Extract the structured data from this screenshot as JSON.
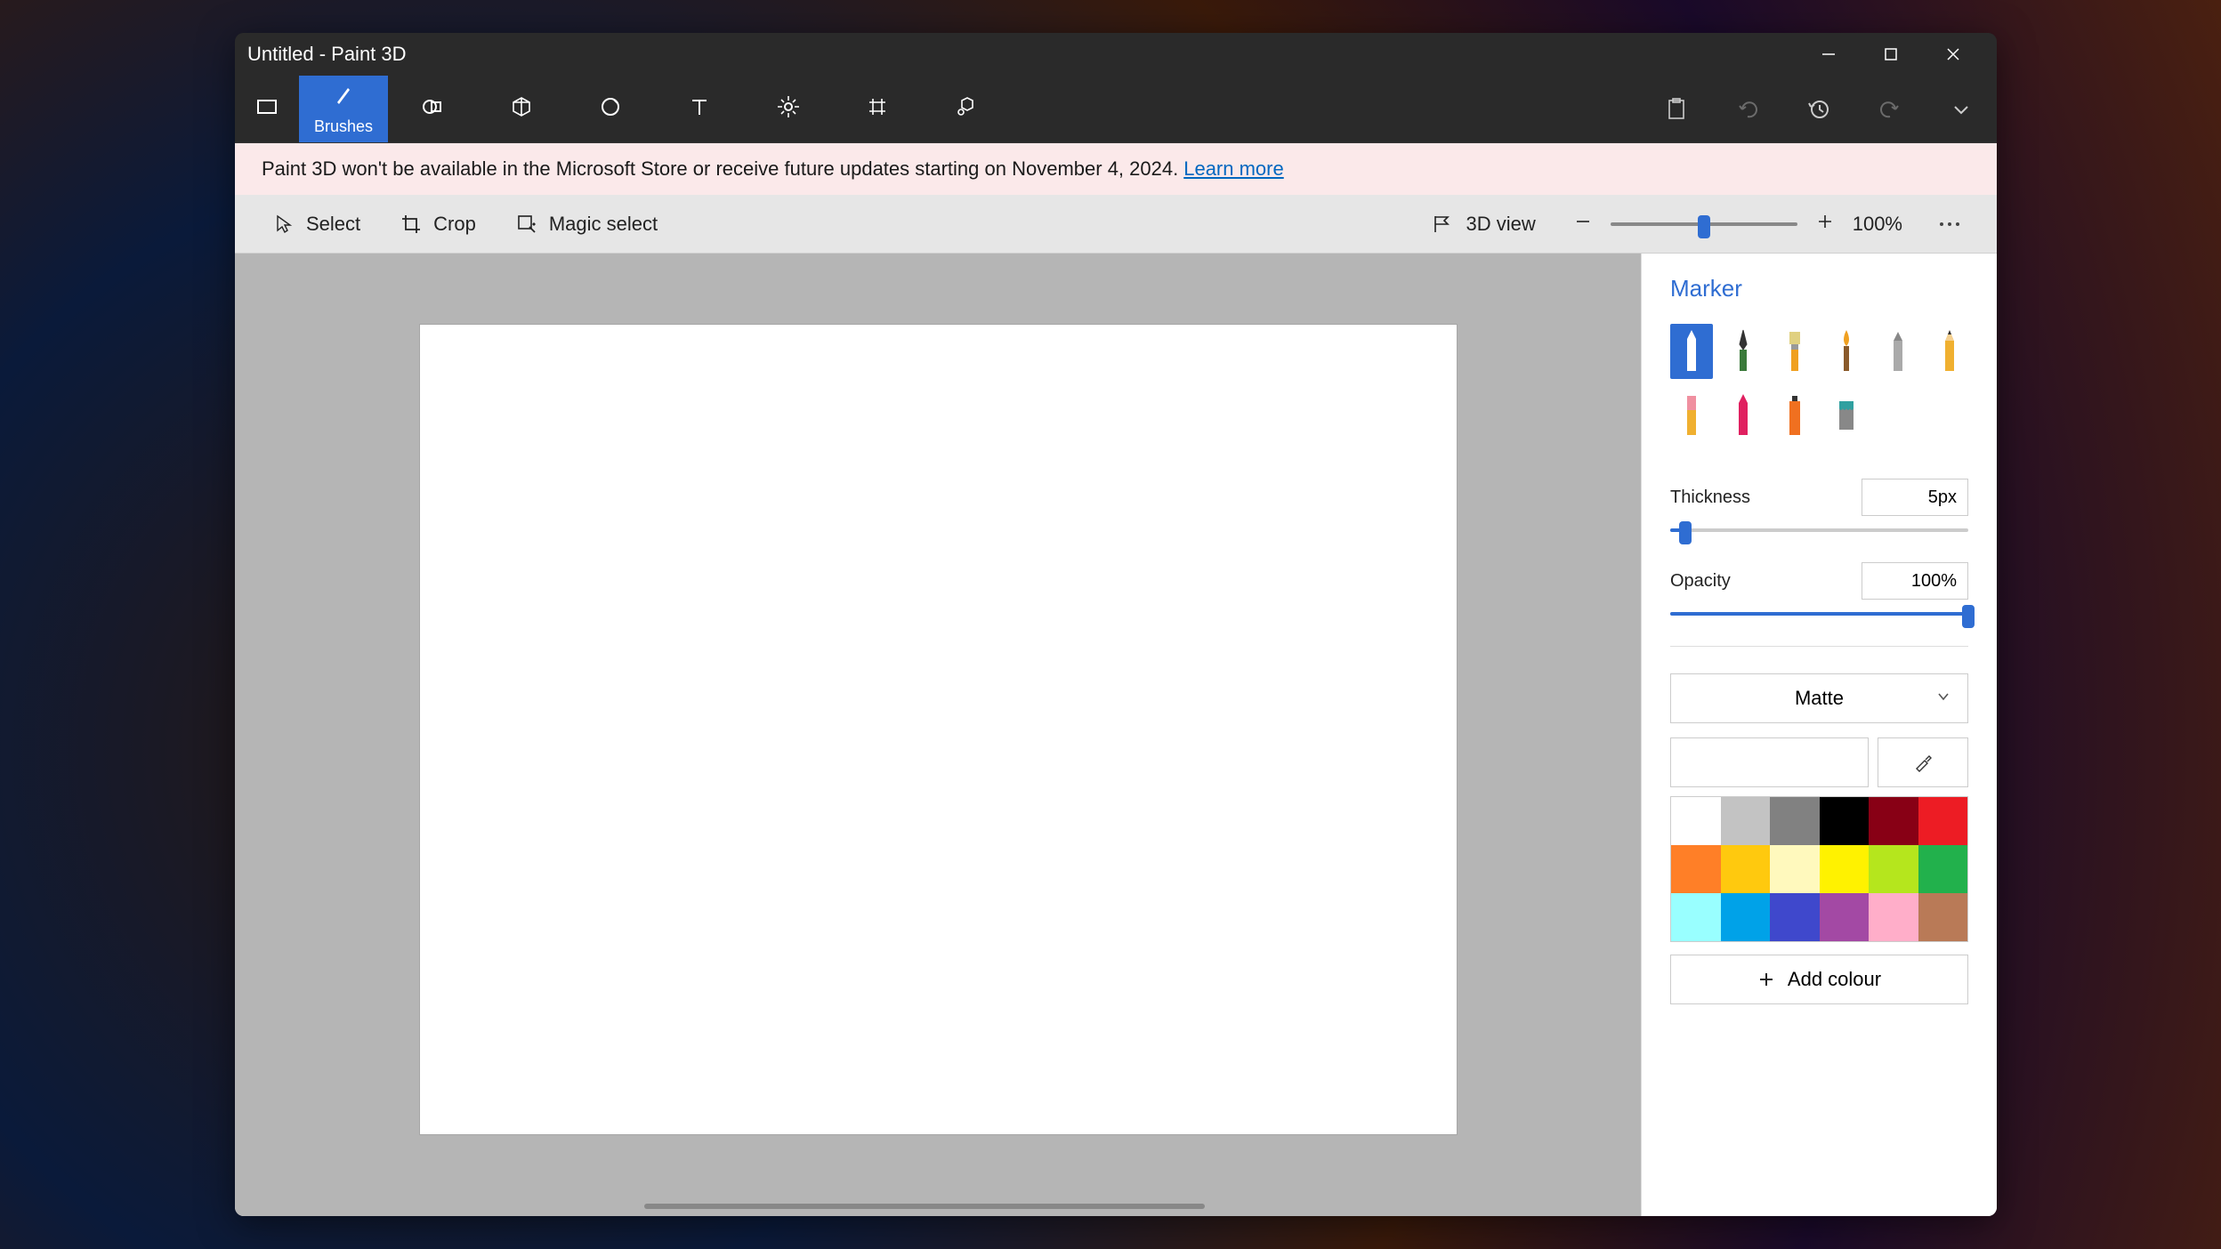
{
  "title": "Untitled - Paint 3D",
  "ribbon": {
    "brushes_label": "Brushes"
  },
  "banner": {
    "text": "Paint 3D won't be available in the Microsoft Store or receive future updates starting on November 4, 2024.",
    "link": "Learn more"
  },
  "subbar": {
    "select": "Select",
    "crop": "Crop",
    "magic_select": "Magic select",
    "view3d": "3D view",
    "zoom": "100%"
  },
  "panel": {
    "heading": "Marker",
    "thickness_label": "Thickness",
    "thickness_value": "5px",
    "thickness_pct": 5,
    "opacity_label": "Opacity",
    "opacity_value": "100%",
    "opacity_pct": 100,
    "material": "Matte",
    "add_colour": "Add colour",
    "brushes": [
      {
        "name": "marker",
        "active": true
      },
      {
        "name": "calligraphy-pen",
        "active": false
      },
      {
        "name": "oil-brush",
        "active": false
      },
      {
        "name": "watercolor",
        "active": false
      },
      {
        "name": "pixel-pen",
        "active": false
      },
      {
        "name": "pencil",
        "active": false
      },
      {
        "name": "eraser",
        "active": false
      },
      {
        "name": "crayon",
        "active": false
      },
      {
        "name": "spray-can",
        "active": false
      },
      {
        "name": "fill",
        "active": false
      }
    ],
    "palette": [
      "#ffffff",
      "#c3c3c3",
      "#818181",
      "#000000",
      "#880015",
      "#ed1c24",
      "#ff7f27",
      "#ffc90e",
      "#fff9bd",
      "#fff200",
      "#b5e61d",
      "#22b14c",
      "#99ffff",
      "#00a2e8",
      "#3f48cc",
      "#a349a4",
      "#ffaec9",
      "#b97a57"
    ]
  }
}
